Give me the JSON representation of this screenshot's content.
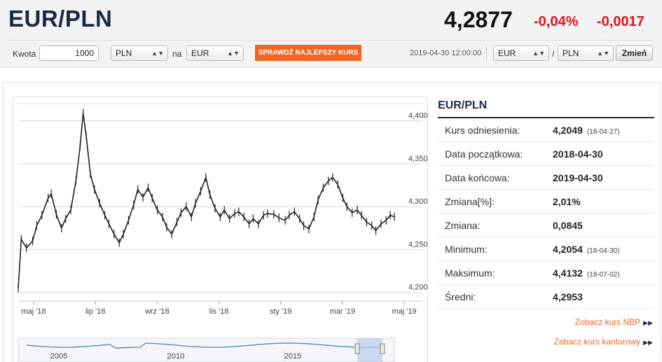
{
  "header": {
    "pair": "EUR/PLN",
    "rate": "4,2877",
    "change_pct": "-0,04%",
    "change_abs": "-0,0017",
    "colors": {
      "negative": "#e3141c",
      "brand": "#1b2a44",
      "accent": "#f26522"
    }
  },
  "converter": {
    "amount_label": "Kwota",
    "amount_value": "1000",
    "from_currency": "PLN",
    "connector": "na",
    "to_currency": "EUR",
    "cta_label": "SPRAWDŹ NAJLEPSZY KURS"
  },
  "pair_selector": {
    "datetime": "2019-04-30 12:00:00",
    "base": "EUR",
    "slash": "/",
    "quote": "PLN",
    "change_button": "Zmień"
  },
  "chart_data": {
    "type": "line",
    "title": "",
    "xlabel": "",
    "ylabel": "",
    "x_ticks": [
      "maj '18",
      "lip '18",
      "wrz '18",
      "lis '18",
      "sty '19",
      "mar '19",
      "maj '19"
    ],
    "y_ticks": [
      "4,2000",
      "4,2500",
      "4,3000",
      "4,3500",
      "4,4000"
    ],
    "ylim": [
      4.19,
      4.42
    ],
    "xlim": [
      "2018-04-30",
      "2019-04-30"
    ],
    "series": [
      {
        "color": "#222222",
        "points": [
          [
            "2018-04-30",
            4.205
          ],
          [
            "2018-05-03",
            4.262
          ],
          [
            "2018-05-08",
            4.252
          ],
          [
            "2018-05-14",
            4.26
          ],
          [
            "2018-05-18",
            4.278
          ],
          [
            "2018-05-23",
            4.29
          ],
          [
            "2018-05-29",
            4.31
          ],
          [
            "2018-06-01",
            4.315
          ],
          [
            "2018-06-06",
            4.291
          ],
          [
            "2018-06-11",
            4.275
          ],
          [
            "2018-06-15",
            4.286
          ],
          [
            "2018-06-20",
            4.296
          ],
          [
            "2018-06-25",
            4.33
          ],
          [
            "2018-06-29",
            4.37
          ],
          [
            "2018-07-02",
            4.409
          ],
          [
            "2018-07-05",
            4.382
          ],
          [
            "2018-07-09",
            4.338
          ],
          [
            "2018-07-13",
            4.32
          ],
          [
            "2018-07-18",
            4.304
          ],
          [
            "2018-07-23",
            4.29
          ],
          [
            "2018-07-27",
            4.28
          ],
          [
            "2018-08-01",
            4.268
          ],
          [
            "2018-08-06",
            4.258
          ],
          [
            "2018-08-10",
            4.268
          ],
          [
            "2018-08-15",
            4.284
          ],
          [
            "2018-08-20",
            4.302
          ],
          [
            "2018-08-24",
            4.32
          ],
          [
            "2018-08-29",
            4.311
          ],
          [
            "2018-09-03",
            4.322
          ],
          [
            "2018-09-07",
            4.31
          ],
          [
            "2018-09-12",
            4.296
          ],
          [
            "2018-09-17",
            4.288
          ],
          [
            "2018-09-21",
            4.276
          ],
          [
            "2018-09-26",
            4.268
          ],
          [
            "2018-10-01",
            4.282
          ],
          [
            "2018-10-05",
            4.293
          ],
          [
            "2018-10-10",
            4.3
          ],
          [
            "2018-10-15",
            4.288
          ],
          [
            "2018-10-19",
            4.304
          ],
          [
            "2018-10-24",
            4.318
          ],
          [
            "2018-10-29",
            4.334
          ],
          [
            "2018-11-02",
            4.314
          ],
          [
            "2018-11-07",
            4.298
          ],
          [
            "2018-11-12",
            4.288
          ],
          [
            "2018-11-16",
            4.296
          ],
          [
            "2018-11-21",
            4.286
          ],
          [
            "2018-11-26",
            4.292
          ],
          [
            "2018-11-30",
            4.294
          ],
          [
            "2018-12-05",
            4.288
          ],
          [
            "2018-12-10",
            4.28
          ],
          [
            "2018-12-14",
            4.286
          ],
          [
            "2018-12-19",
            4.28
          ],
          [
            "2018-12-24",
            4.29
          ],
          [
            "2018-12-28",
            4.292
          ],
          [
            "2019-01-03",
            4.291
          ],
          [
            "2019-01-08",
            4.287
          ],
          [
            "2019-01-14",
            4.284
          ],
          [
            "2019-01-18",
            4.29
          ],
          [
            "2019-01-23",
            4.294
          ],
          [
            "2019-01-28",
            4.286
          ],
          [
            "2019-02-01",
            4.278
          ],
          [
            "2019-02-06",
            4.274
          ],
          [
            "2019-02-11",
            4.288
          ],
          [
            "2019-02-15",
            4.308
          ],
          [
            "2019-02-20",
            4.322
          ],
          [
            "2019-02-25",
            4.33
          ],
          [
            "2019-03-01",
            4.334
          ],
          [
            "2019-03-06",
            4.326
          ],
          [
            "2019-03-11",
            4.31
          ],
          [
            "2019-03-15",
            4.3
          ],
          [
            "2019-03-20",
            4.293
          ],
          [
            "2019-03-25",
            4.296
          ],
          [
            "2019-03-29",
            4.29
          ],
          [
            "2019-04-03",
            4.282
          ],
          [
            "2019-04-08",
            4.278
          ],
          [
            "2019-04-12",
            4.272
          ],
          [
            "2019-04-17",
            4.28
          ],
          [
            "2019-04-22",
            4.284
          ],
          [
            "2019-04-26",
            4.29
          ],
          [
            "2019-04-30",
            4.288
          ]
        ]
      }
    ],
    "navigator": {
      "x_ticks": [
        "2005",
        "2010",
        "2015"
      ],
      "selected_range": [
        "2018-04-30",
        "2019-04-30"
      ]
    },
    "grid": true
  },
  "summary": {
    "title": "EUR/PLN",
    "rows": [
      {
        "label": "Kurs odniesienia:",
        "value": "4,2049",
        "date": "(18-04-27)"
      },
      {
        "label": "Data początkowa:",
        "value": "2018-04-30",
        "date": ""
      },
      {
        "label": "Data końcowa:",
        "value": "2019-04-30",
        "date": ""
      },
      {
        "label": "Zmiana[%]:",
        "value": "2,01%",
        "date": ""
      },
      {
        "label": "Zmiana:",
        "value": "0,0845",
        "date": ""
      },
      {
        "label": "Minimum:",
        "value": "4,2054",
        "date": "(18-04-30)"
      },
      {
        "label": "Maksimum:",
        "value": "4,4132",
        "date": "(18-07-02)"
      },
      {
        "label": "Średni:",
        "value": "4,2953",
        "date": ""
      }
    ],
    "links": {
      "nbp": "Zobacz kurs NBP",
      "kantor": "Zobacz kurs kantorowy"
    }
  }
}
